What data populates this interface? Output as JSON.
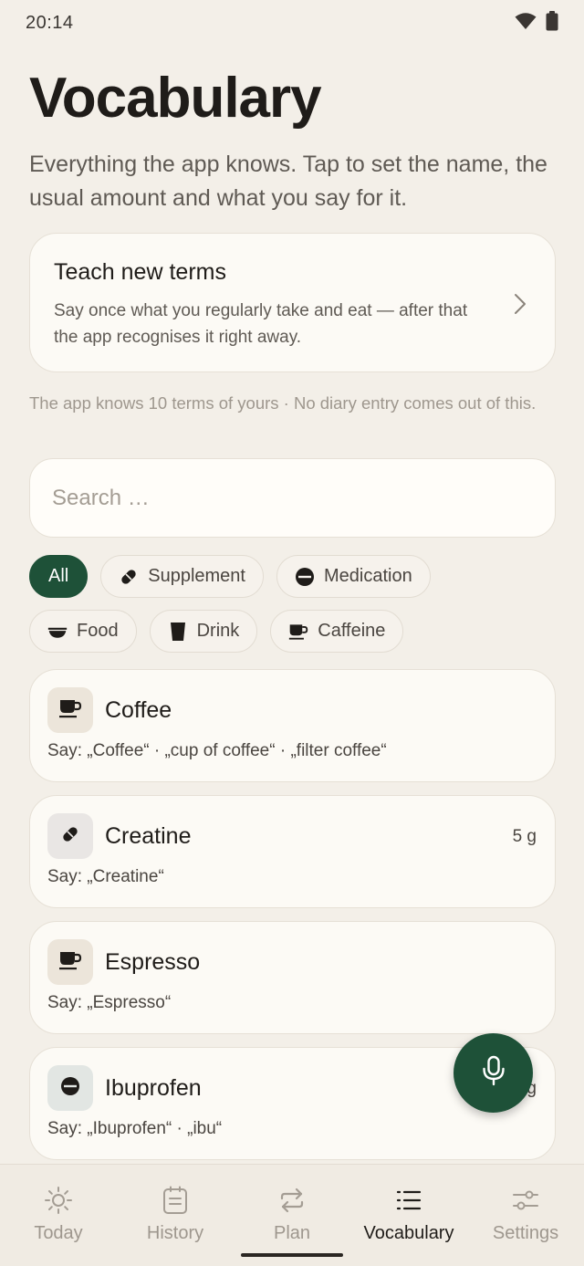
{
  "status": {
    "time": "20:14",
    "icons": [
      "wifi-icon",
      "battery-icon"
    ]
  },
  "header": {
    "title": "Vocabulary",
    "subtitle": "Everything the app knows. Tap to set the name, the usual amount and what you say for it."
  },
  "teach": {
    "title": "Teach new terms",
    "description": "Say once what you regularly take and eat — after that the app recognises it right away.",
    "icon": "chevron-right-icon"
  },
  "known_note": "The app knows 10 terms of yours · No diary entry comes out of this.",
  "search": {
    "placeholder": "Search …",
    "value": ""
  },
  "filters": [
    {
      "label": "All",
      "icon": "",
      "active": true
    },
    {
      "label": "Supplement",
      "icon": "pill-icon",
      "active": false
    },
    {
      "label": "Medication",
      "icon": "tablet-icon",
      "active": false
    },
    {
      "label": "Food",
      "icon": "bowl-icon",
      "active": false
    },
    {
      "label": "Drink",
      "icon": "glass-icon",
      "active": false
    },
    {
      "label": "Caffeine",
      "icon": "cup-icon",
      "active": false
    }
  ],
  "terms": [
    {
      "name": "Coffee",
      "amount": "",
      "say": "Say: „Coffee“ · „cup of coffee“ · „filter coffee“",
      "icon": "cup-icon",
      "icon_bg": "#ece5da"
    },
    {
      "name": "Creatine",
      "amount": "5 g",
      "say": "Say: „Creatine“",
      "icon": "pill-icon",
      "icon_bg": "#e9e6e4"
    },
    {
      "name": "Espresso",
      "amount": "",
      "say": "Say: „Espresso“",
      "icon": "cup-icon",
      "icon_bg": "#ece5da"
    },
    {
      "name": "Ibuprofen",
      "amount": "g",
      "say": "Say: „Ibuprofen“ · „ibu“",
      "icon": "tablet-icon",
      "icon_bg": "#e2e6e3"
    }
  ],
  "fab": {
    "icon": "microphone-icon"
  },
  "nav": [
    {
      "label": "Today",
      "icon": "sun-icon",
      "active": false
    },
    {
      "label": "History",
      "icon": "journal-icon",
      "active": false
    },
    {
      "label": "Plan",
      "icon": "repeat-icon",
      "active": false
    },
    {
      "label": "Vocabulary",
      "icon": "list-icon",
      "active": true
    },
    {
      "label": "Settings",
      "icon": "sliders-icon",
      "active": false
    }
  ],
  "colors": {
    "accent": "#1e5138",
    "background": "#f3efe8",
    "card": "#fcfaf5"
  }
}
